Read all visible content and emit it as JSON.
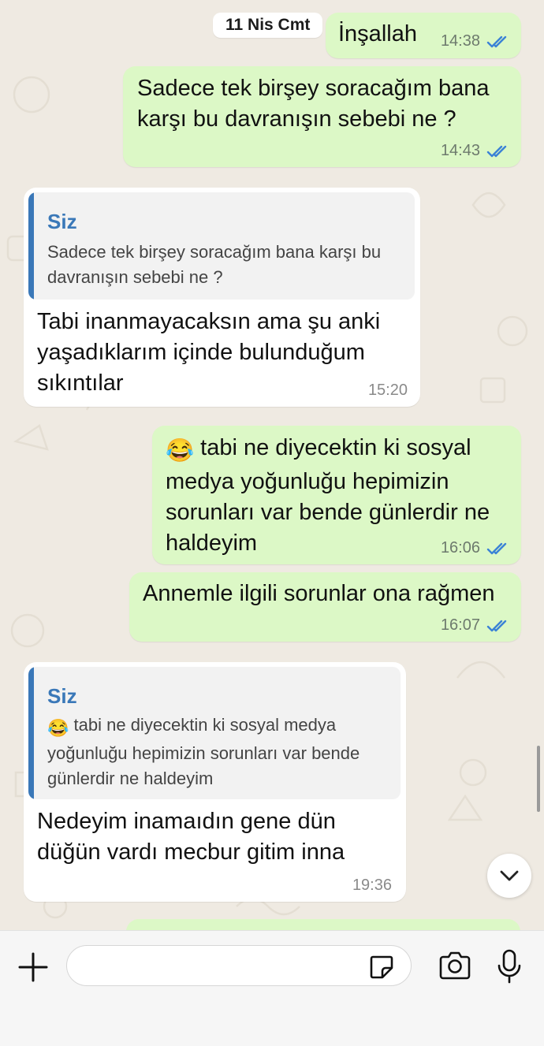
{
  "date_pill": "11 Nis Cmt",
  "colors": {
    "outgoing_bubble": "#dcf8c6",
    "incoming_bubble": "#ffffff",
    "read_ticks": "#3b82d6",
    "quote_accent": "#3a78b8",
    "background": "#efeae2"
  },
  "messages": [
    {
      "id": "m1",
      "direction": "outgoing",
      "text": "İnşallah",
      "time": "14:38",
      "status_icon": "double-check-read-icon"
    },
    {
      "id": "m2",
      "direction": "outgoing",
      "text": "Sadece tek birşey soracağım bana\nkarşı bu davranışın sebebi ne ?",
      "time": "14:43",
      "status_icon": "double-check-read-icon"
    },
    {
      "id": "m3",
      "direction": "incoming",
      "quote": {
        "author": "Siz",
        "text": "Sadece tek birşey soracağım bana karşı bu\ndavranışın sebebi ne ?"
      },
      "text": "Tabi inanmayacaksın ama şu anki\nyaşadıklarım içinde bulunduğum\nsıkıntılar",
      "time": "15:20"
    },
    {
      "id": "m4",
      "direction": "outgoing",
      "emoji": "😂",
      "text": "tabi ne diyecektin ki sosyal\nmedya yoğunluğu hepimizin\nsorunları var bende günlerdir ne\nhaldeyim",
      "time": "16:06",
      "status_icon": "double-check-read-icon"
    },
    {
      "id": "m5",
      "direction": "outgoing",
      "text": "Annemle ilgili sorunlar ona rağmen",
      "time": "16:07",
      "status_icon": "double-check-read-icon"
    },
    {
      "id": "m6",
      "direction": "incoming",
      "quote": {
        "author": "Siz",
        "emoji": "😂",
        "text": "tabi ne diyecektin ki sosyal medya\nyoğunluğu hepimizin sorunları var bende\ngünlerdir ne haldeyim"
      },
      "text": "Nedeyim inamaıdın gene dün\ndüğün vardı mecbur gitim inna",
      "time": "19:36"
    }
  ],
  "input_bar": {
    "plus_icon": "plus-icon",
    "message_value": "",
    "message_placeholder": "",
    "sticker_icon": "sticker-icon",
    "camera_icon": "camera-icon",
    "mic_icon": "microphone-icon"
  },
  "scroll_down_icon": "chevron-down-icon"
}
